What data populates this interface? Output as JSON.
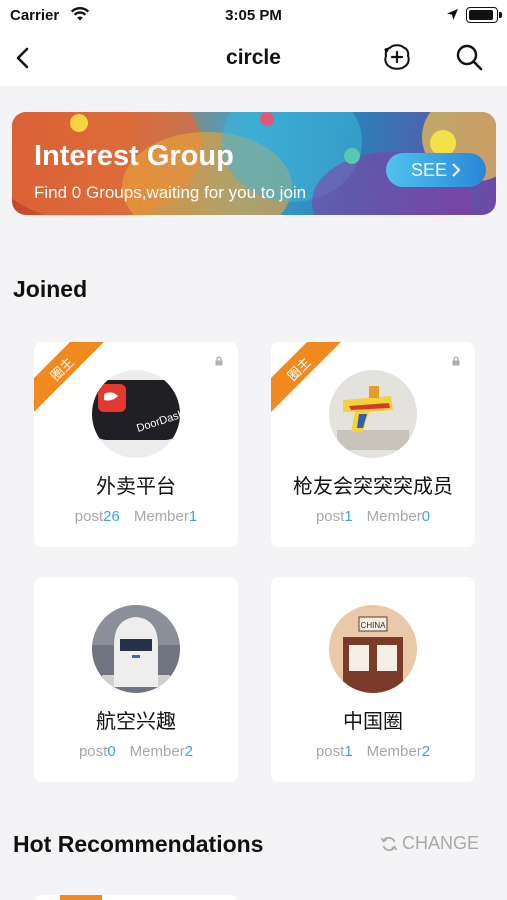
{
  "status": {
    "carrier": "Carrier",
    "time": "3:05 PM"
  },
  "nav": {
    "title": "circle"
  },
  "banner": {
    "title": "Interest Group",
    "subtitle": "Find 0 Groups,waiting for you to join",
    "button": "SEE"
  },
  "sections": {
    "joined": "Joined",
    "hot": "Hot Recommendations",
    "change": "CHANGE"
  },
  "labels": {
    "post": "post",
    "member": "Member",
    "owner_badge": "圈主"
  },
  "groups": [
    {
      "name": "外卖平台",
      "posts": "26",
      "members": "1"
    },
    {
      "name": "枪友会突突突成员",
      "posts": "1",
      "members": "0"
    },
    {
      "name": "航空兴趣",
      "posts": "0",
      "members": "2"
    },
    {
      "name": "中国圈",
      "posts": "1",
      "members": "2"
    }
  ],
  "avatar_texts": {
    "doordash": "DoorDash",
    "china_sign": "CHINA"
  }
}
